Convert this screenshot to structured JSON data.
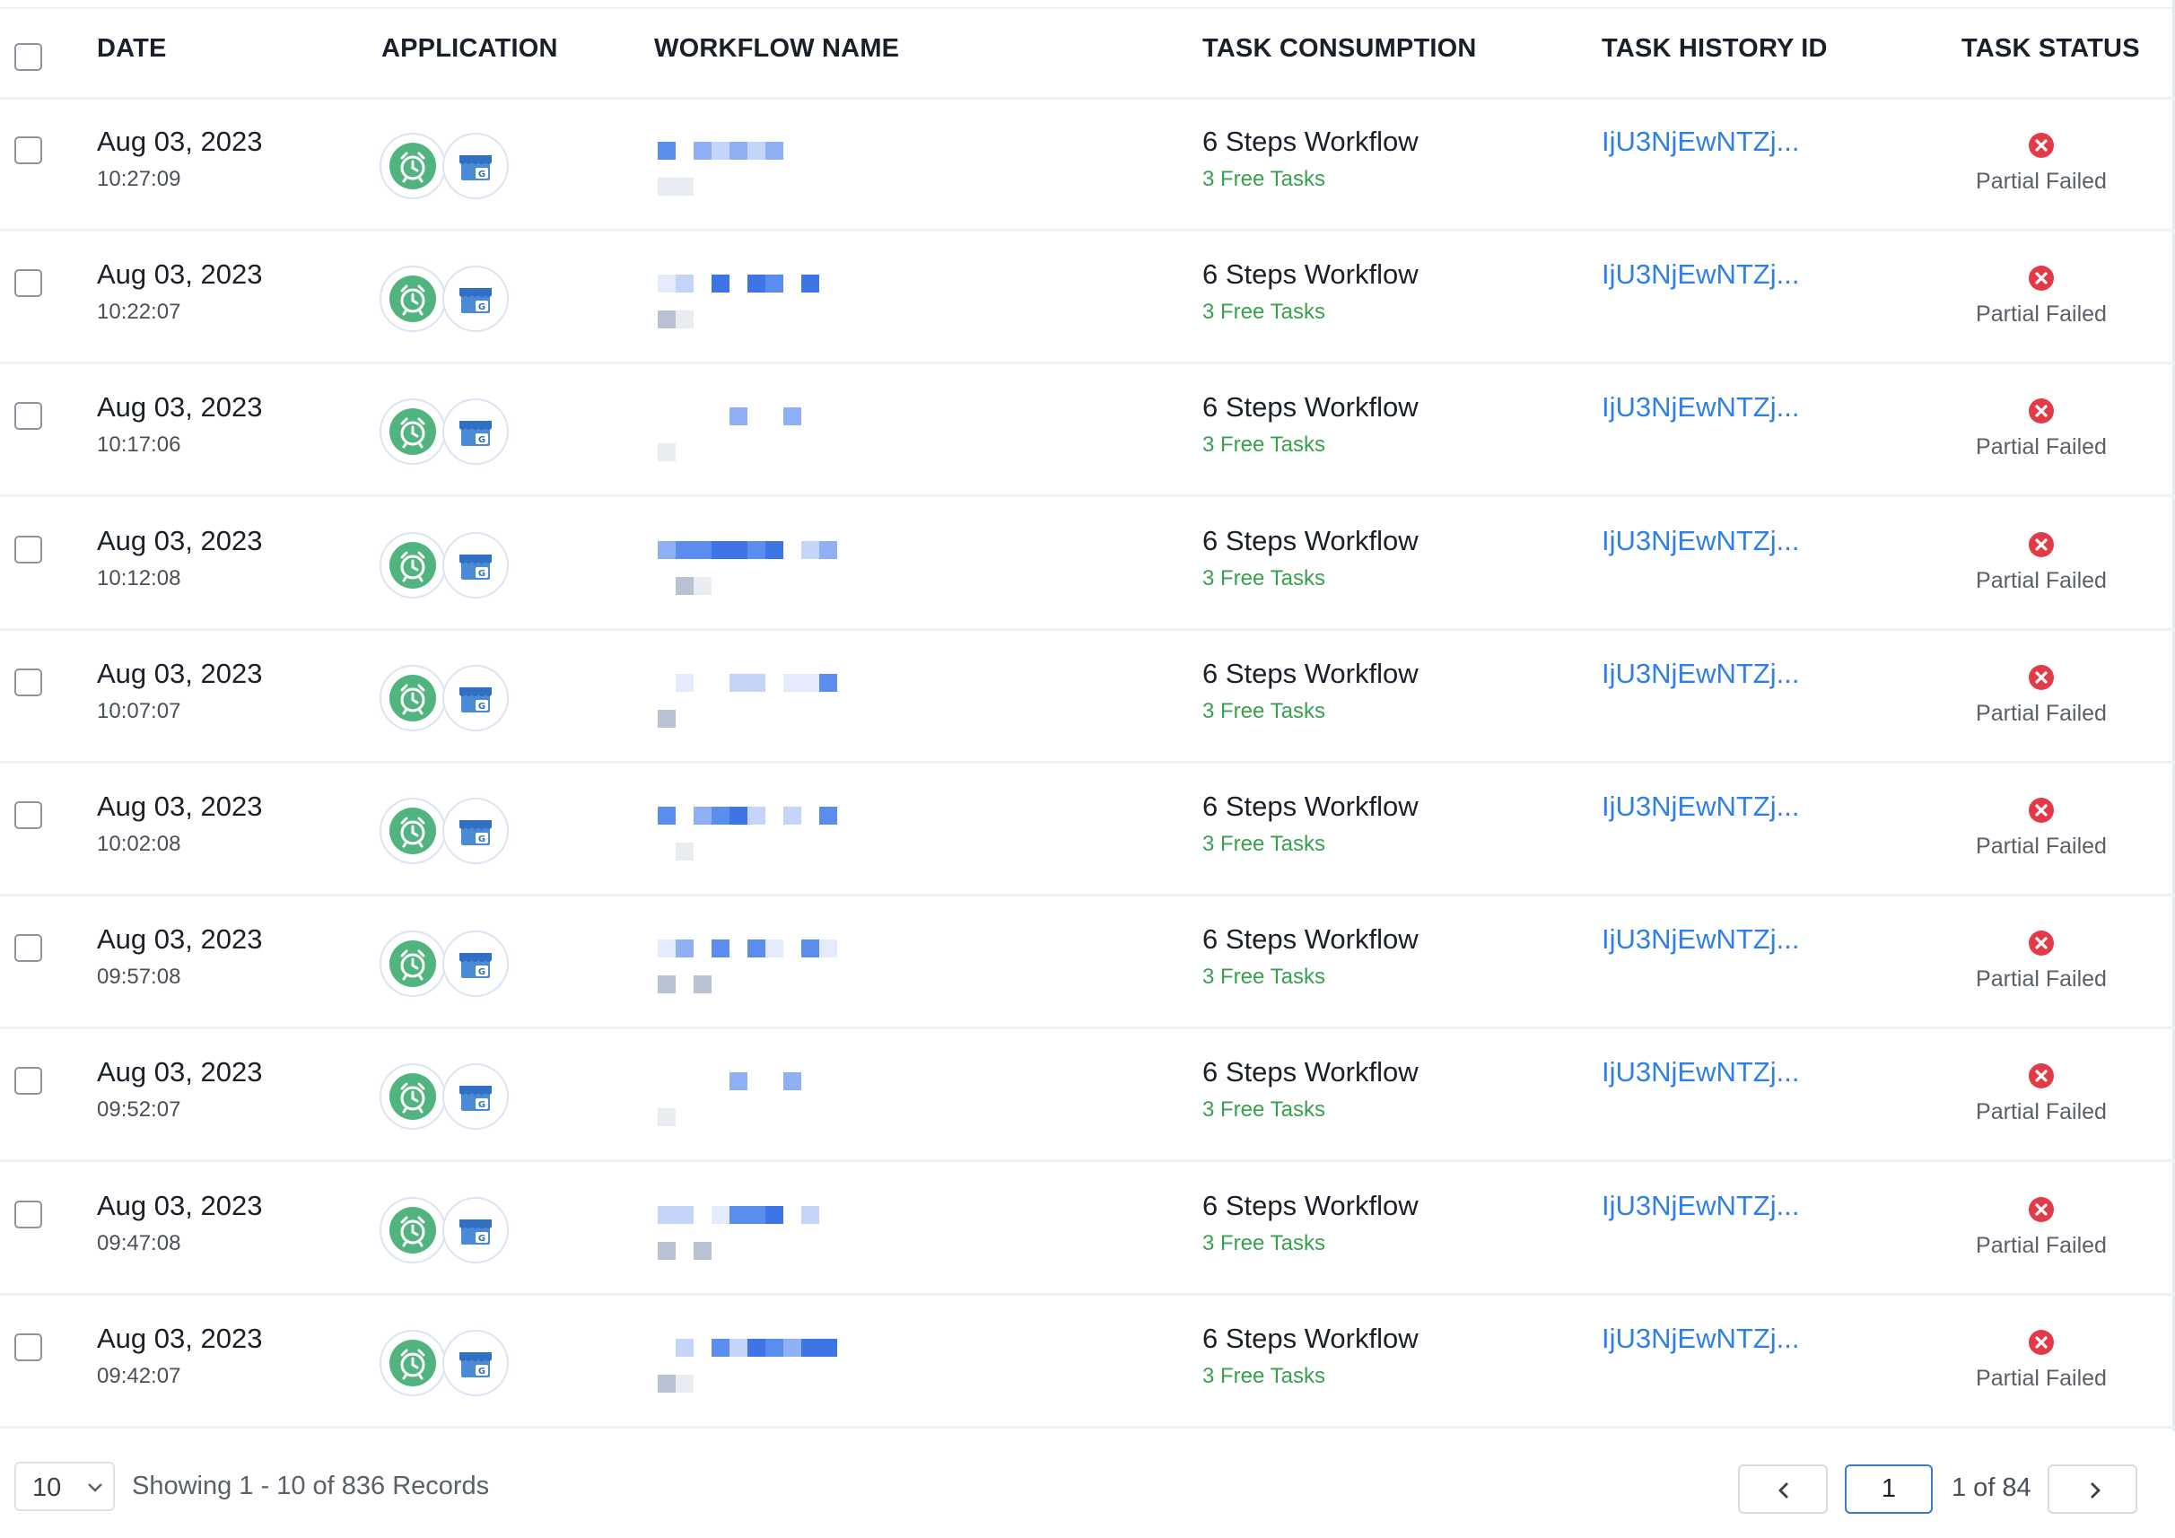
{
  "header": {
    "date": "DATE",
    "application": "APPLICATION",
    "workflow_name": "WORKFLOW NAME",
    "task_consumption": "TASK CONSUMPTION",
    "task_history_id": "TASK HISTORY ID",
    "task_status": "TASK STATUS"
  },
  "rows": [
    {
      "date": "Aug 03, 2023",
      "time": "10:27:09",
      "consumption": "6 Steps Workflow",
      "free_tasks": "3 Free Tasks",
      "history_id": "IjU3NjEwNTZj...",
      "status": "Partial Failed"
    },
    {
      "date": "Aug 03, 2023",
      "time": "10:22:07",
      "consumption": "6 Steps Workflow",
      "free_tasks": "3 Free Tasks",
      "history_id": "IjU3NjEwNTZj...",
      "status": "Partial Failed"
    },
    {
      "date": "Aug 03, 2023",
      "time": "10:17:06",
      "consumption": "6 Steps Workflow",
      "free_tasks": "3 Free Tasks",
      "history_id": "IjU3NjEwNTZj...",
      "status": "Partial Failed"
    },
    {
      "date": "Aug 03, 2023",
      "time": "10:12:08",
      "consumption": "6 Steps Workflow",
      "free_tasks": "3 Free Tasks",
      "history_id": "IjU3NjEwNTZj...",
      "status": "Partial Failed"
    },
    {
      "date": "Aug 03, 2023",
      "time": "10:07:07",
      "consumption": "6 Steps Workflow",
      "free_tasks": "3 Free Tasks",
      "history_id": "IjU3NjEwNTZj...",
      "status": "Partial Failed"
    },
    {
      "date": "Aug 03, 2023",
      "time": "10:02:08",
      "consumption": "6 Steps Workflow",
      "free_tasks": "3 Free Tasks",
      "history_id": "IjU3NjEwNTZj...",
      "status": "Partial Failed"
    },
    {
      "date": "Aug 03, 2023",
      "time": "09:57:08",
      "consumption": "6 Steps Workflow",
      "free_tasks": "3 Free Tasks",
      "history_id": "IjU3NjEwNTZj...",
      "status": "Partial Failed"
    },
    {
      "date": "Aug 03, 2023",
      "time": "09:52:07",
      "consumption": "6 Steps Workflow",
      "free_tasks": "3 Free Tasks",
      "history_id": "IjU3NjEwNTZj...",
      "status": "Partial Failed"
    },
    {
      "date": "Aug 03, 2023",
      "time": "09:47:08",
      "consumption": "6 Steps Workflow",
      "free_tasks": "3 Free Tasks",
      "history_id": "IjU3NjEwNTZj...",
      "status": "Partial Failed"
    },
    {
      "date": "Aug 03, 2023",
      "time": "09:42:07",
      "consumption": "6 Steps Workflow",
      "free_tasks": "3 Free Tasks",
      "history_id": "IjU3NjEwNTZj...",
      "status": "Partial Failed"
    }
  ],
  "icons": {
    "app_1": "alarm-clock-icon",
    "app_2": "google-my-business-icon",
    "status": "error-x-icon",
    "prev": "chevron-left-icon",
    "next": "chevron-right-icon",
    "dropdown": "chevron-down-icon"
  },
  "colors": {
    "link": "#2f7fe8",
    "free_tasks": "#38a04f",
    "status_failed": "#e23b47",
    "alarm_app": "#51b37e",
    "gmb_app": "#4a8ad6"
  },
  "footer": {
    "page_size": "10",
    "showing": "Showing 1 - 10 of 836 Records",
    "current_page": "1",
    "page_of": "1 of 84"
  }
}
